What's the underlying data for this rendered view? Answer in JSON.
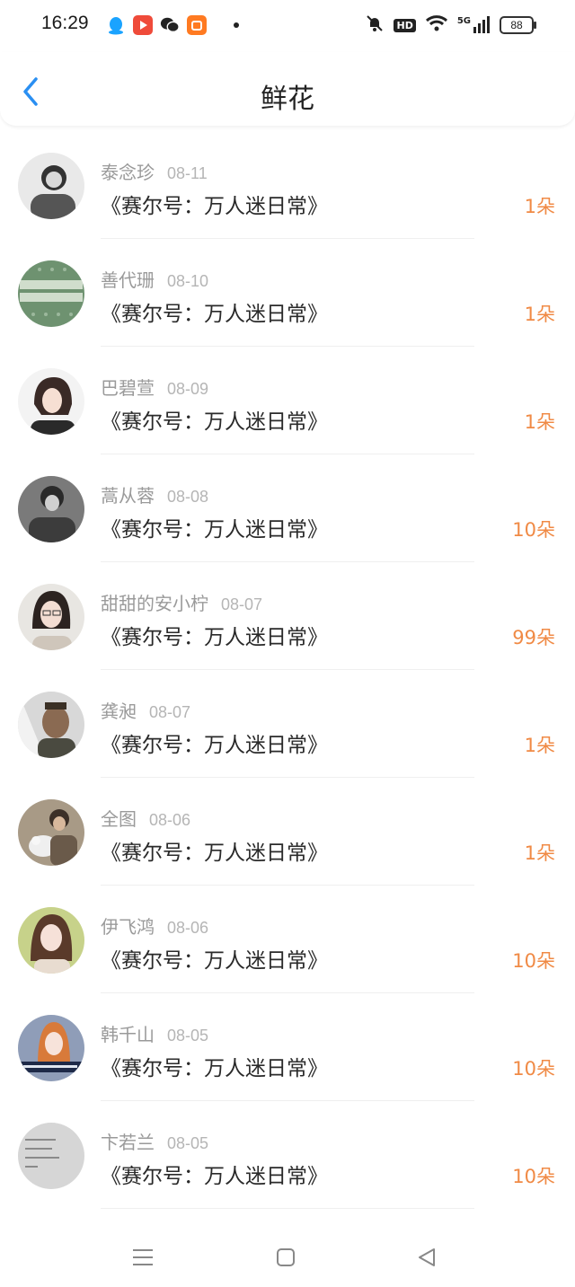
{
  "status": {
    "time": "16:29",
    "apps": [
      "qq-icon",
      "video-app-icon",
      "wechat-icon",
      "shopping-app-icon"
    ],
    "hd_label": "HD",
    "network_label": "5G",
    "battery": "88"
  },
  "header": {
    "title": "鲜花",
    "back_icon": "chevron-left-icon",
    "accent": "#2a8ff2"
  },
  "items": [
    {
      "name": "泰念珍",
      "date": "08-11",
      "book": "《赛尔号：万人迷日常》",
      "count": "1朵"
    },
    {
      "name": "善代珊",
      "date": "08-10",
      "book": "《赛尔号：万人迷日常》",
      "count": "1朵"
    },
    {
      "name": "巴碧萱",
      "date": "08-09",
      "book": "《赛尔号：万人迷日常》",
      "count": "1朵"
    },
    {
      "name": "蒿从蓉",
      "date": "08-08",
      "book": "《赛尔号：万人迷日常》",
      "count": "10朵"
    },
    {
      "name": "甜甜的安小柠",
      "date": "08-07",
      "book": "《赛尔号：万人迷日常》",
      "count": "99朵"
    },
    {
      "name": "龚昶",
      "date": "08-07",
      "book": "《赛尔号：万人迷日常》",
      "count": "1朵"
    },
    {
      "name": "全图",
      "date": "08-06",
      "book": "《赛尔号：万人迷日常》",
      "count": "1朵"
    },
    {
      "name": "伊飞鸿",
      "date": "08-06",
      "book": "《赛尔号：万人迷日常》",
      "count": "10朵"
    },
    {
      "name": "韩千山",
      "date": "08-05",
      "book": "《赛尔号：万人迷日常》",
      "count": "10朵"
    },
    {
      "name": "卞若兰",
      "date": "08-05",
      "book": "《赛尔号：万人迷日常》",
      "count": "10朵"
    }
  ],
  "count_color": "#f08a45",
  "navbar": {
    "buttons": [
      "menu-icon",
      "home-square-icon",
      "back-triangle-icon"
    ]
  }
}
